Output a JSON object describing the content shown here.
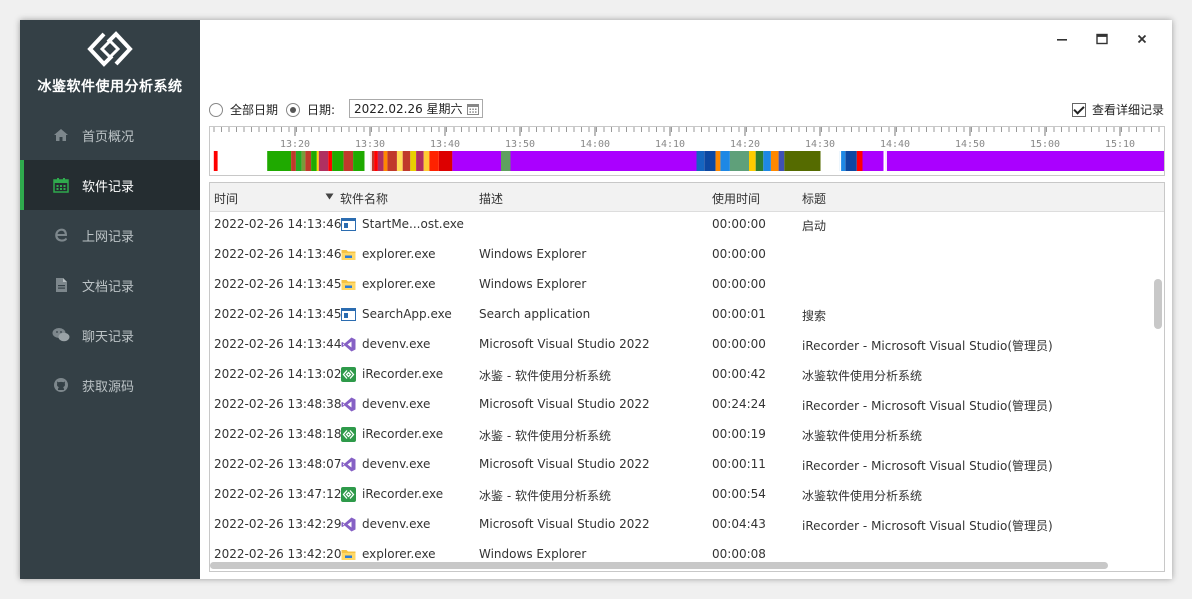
{
  "app": {
    "title": "冰鉴软件使用分析系统",
    "window_controls": {
      "minimize": "−",
      "maximize": "□",
      "close": "×"
    }
  },
  "sidebar": {
    "items": [
      {
        "label": "首页概况",
        "icon": "home-icon"
      },
      {
        "label": "软件记录",
        "icon": "calendar-icon",
        "active": true
      },
      {
        "label": "上网记录",
        "icon": "browser-icon"
      },
      {
        "label": "文档记录",
        "icon": "document-icon"
      },
      {
        "label": "聊天记录",
        "icon": "wechat-icon"
      },
      {
        "label": "获取源码",
        "icon": "github-icon"
      }
    ]
  },
  "filter": {
    "all_dates_label": "全部日期",
    "date_label": "日期:",
    "date_value": "2022.02.26 星期六",
    "selected": "date",
    "show_details_label": "查看详细记录",
    "show_details_checked": true
  },
  "timeline": {
    "tick_labels": [
      "13:20",
      "13:30",
      "13:40",
      "13:50",
      "14:00",
      "14:10",
      "14:20",
      "14:30",
      "14:40",
      "14:50",
      "15:00",
      "15:10"
    ],
    "segments": [
      {
        "from": 0.004,
        "to": 0.008,
        "color": "#ff0000"
      },
      {
        "from": 0.06,
        "to": 0.085,
        "color": "#1faa00"
      },
      {
        "from": 0.085,
        "to": 0.09,
        "color": "#c0392b"
      },
      {
        "from": 0.09,
        "to": 0.096,
        "color": "#22aa22"
      },
      {
        "from": 0.096,
        "to": 0.1,
        "color": "#7a9a3a"
      },
      {
        "from": 0.1,
        "to": 0.106,
        "color": "#c0392b"
      },
      {
        "from": 0.106,
        "to": 0.112,
        "color": "#1faa00"
      },
      {
        "from": 0.112,
        "to": 0.114,
        "color": "#ffd700"
      },
      {
        "from": 0.114,
        "to": 0.124,
        "color": "#b03060"
      },
      {
        "from": 0.124,
        "to": 0.128,
        "color": "#ff0000"
      },
      {
        "from": 0.128,
        "to": 0.14,
        "color": "#1faa00"
      },
      {
        "from": 0.14,
        "to": 0.15,
        "color": "#c0392b"
      },
      {
        "from": 0.15,
        "to": 0.162,
        "color": "#1faa00"
      },
      {
        "from": 0.168,
        "to": 0.172,
        "color": "#c0392b"
      },
      {
        "from": 0.172,
        "to": 0.176,
        "color": "#ff0000"
      },
      {
        "from": 0.176,
        "to": 0.182,
        "color": "#b03060"
      },
      {
        "from": 0.182,
        "to": 0.186,
        "color": "#ff8800"
      },
      {
        "from": 0.186,
        "to": 0.196,
        "color": "#c0392b"
      },
      {
        "from": 0.196,
        "to": 0.202,
        "color": "#ffdd55"
      },
      {
        "from": 0.202,
        "to": 0.21,
        "color": "#c0392b"
      },
      {
        "from": 0.21,
        "to": 0.216,
        "color": "#e8d000"
      },
      {
        "from": 0.216,
        "to": 0.224,
        "color": "#b03060"
      },
      {
        "from": 0.224,
        "to": 0.23,
        "color": "#ffcc33"
      },
      {
        "from": 0.23,
        "to": 0.24,
        "color": "#ff2200"
      },
      {
        "from": 0.24,
        "to": 0.254,
        "color": "#dd0000"
      },
      {
        "from": 0.254,
        "to": 0.305,
        "color": "#aa00ff"
      },
      {
        "from": 0.305,
        "to": 0.315,
        "color": "#5fa05f"
      },
      {
        "from": 0.315,
        "to": 0.51,
        "color": "#aa00ff"
      },
      {
        "from": 0.51,
        "to": 0.518,
        "color": "#1565c0"
      },
      {
        "from": 0.518,
        "to": 0.53,
        "color": "#0d47a1"
      },
      {
        "from": 0.53,
        "to": 0.535,
        "color": "#ff8800"
      },
      {
        "from": 0.535,
        "to": 0.545,
        "color": "#1e88e5"
      },
      {
        "from": 0.545,
        "to": 0.565,
        "color": "#5fa07a"
      },
      {
        "from": 0.565,
        "to": 0.572,
        "color": "#ffcc00"
      },
      {
        "from": 0.572,
        "to": 0.58,
        "color": "#2e7d32"
      },
      {
        "from": 0.58,
        "to": 0.588,
        "color": "#1e88e5"
      },
      {
        "from": 0.588,
        "to": 0.596,
        "color": "#ff8800"
      },
      {
        "from": 0.596,
        "to": 0.602,
        "color": "#3f51b5"
      },
      {
        "from": 0.602,
        "to": 0.64,
        "color": "#556b00"
      },
      {
        "from": 0.66,
        "to": 0.666,
        "color": "#1e88e5"
      },
      {
        "from": 0.666,
        "to": 0.678,
        "color": "#0d47a1"
      },
      {
        "from": 0.678,
        "to": 0.684,
        "color": "#ff0000"
      },
      {
        "from": 0.684,
        "to": 0.706,
        "color": "#aa00ff"
      },
      {
        "from": 0.708,
        "to": 1.0,
        "color": "#aa00ff"
      }
    ]
  },
  "table": {
    "headers": [
      "时间",
      "软件名称",
      "描述",
      "使用时间",
      "标题"
    ],
    "rows": [
      {
        "time": "2022-02-26 14:13:46",
        "app": "StartMe...ost.exe",
        "icon": "window-app-icon",
        "desc": "",
        "usage": "00:00:00",
        "title": "启动"
      },
      {
        "time": "2022-02-26 14:13:46",
        "app": "explorer.exe",
        "icon": "folder-icon",
        "desc": "Windows Explorer",
        "usage": "00:00:00",
        "title": ""
      },
      {
        "time": "2022-02-26 14:13:45",
        "app": "explorer.exe",
        "icon": "folder-icon",
        "desc": "Windows Explorer",
        "usage": "00:00:00",
        "title": ""
      },
      {
        "time": "2022-02-26 14:13:45",
        "app": "SearchApp.exe",
        "icon": "window-app-icon",
        "desc": "Search application",
        "usage": "00:00:01",
        "title": "搜索"
      },
      {
        "time": "2022-02-26 14:13:44",
        "app": "devenv.exe",
        "icon": "visual-studio-icon",
        "desc": "Microsoft Visual Studio 2022",
        "usage": "00:00:00",
        "title": "iRecorder - Microsoft Visual Studio(管理员)"
      },
      {
        "time": "2022-02-26 14:13:02",
        "app": "iRecorder.exe",
        "icon": "irecorder-icon",
        "desc": "冰鉴 - 软件使用分析系统",
        "usage": "00:00:42",
        "title": "冰鉴软件使用分析系统"
      },
      {
        "time": "2022-02-26 13:48:38",
        "app": "devenv.exe",
        "icon": "visual-studio-icon",
        "desc": "Microsoft Visual Studio 2022",
        "usage": "00:24:24",
        "title": "iRecorder - Microsoft Visual Studio(管理员)"
      },
      {
        "time": "2022-02-26 13:48:18",
        "app": "iRecorder.exe",
        "icon": "irecorder-icon",
        "desc": "冰鉴 - 软件使用分析系统",
        "usage": "00:00:19",
        "title": "冰鉴软件使用分析系统"
      },
      {
        "time": "2022-02-26 13:48:07",
        "app": "devenv.exe",
        "icon": "visual-studio-icon",
        "desc": "Microsoft Visual Studio 2022",
        "usage": "00:00:11",
        "title": "iRecorder - Microsoft Visual Studio(管理员)"
      },
      {
        "time": "2022-02-26 13:47:12",
        "app": "iRecorder.exe",
        "icon": "irecorder-icon",
        "desc": "冰鉴 - 软件使用分析系统",
        "usage": "00:00:54",
        "title": "冰鉴软件使用分析系统"
      },
      {
        "time": "2022-02-26 13:42:29",
        "app": "devenv.exe",
        "icon": "visual-studio-icon",
        "desc": "Microsoft Visual Studio 2022",
        "usage": "00:04:43",
        "title": "iRecorder - Microsoft Visual Studio(管理员)"
      },
      {
        "time": "2022-02-26 13:42:20",
        "app": "explorer.exe",
        "icon": "folder-icon",
        "desc": "Windows Explorer",
        "usage": "00:00:08",
        "title": ""
      }
    ]
  }
}
